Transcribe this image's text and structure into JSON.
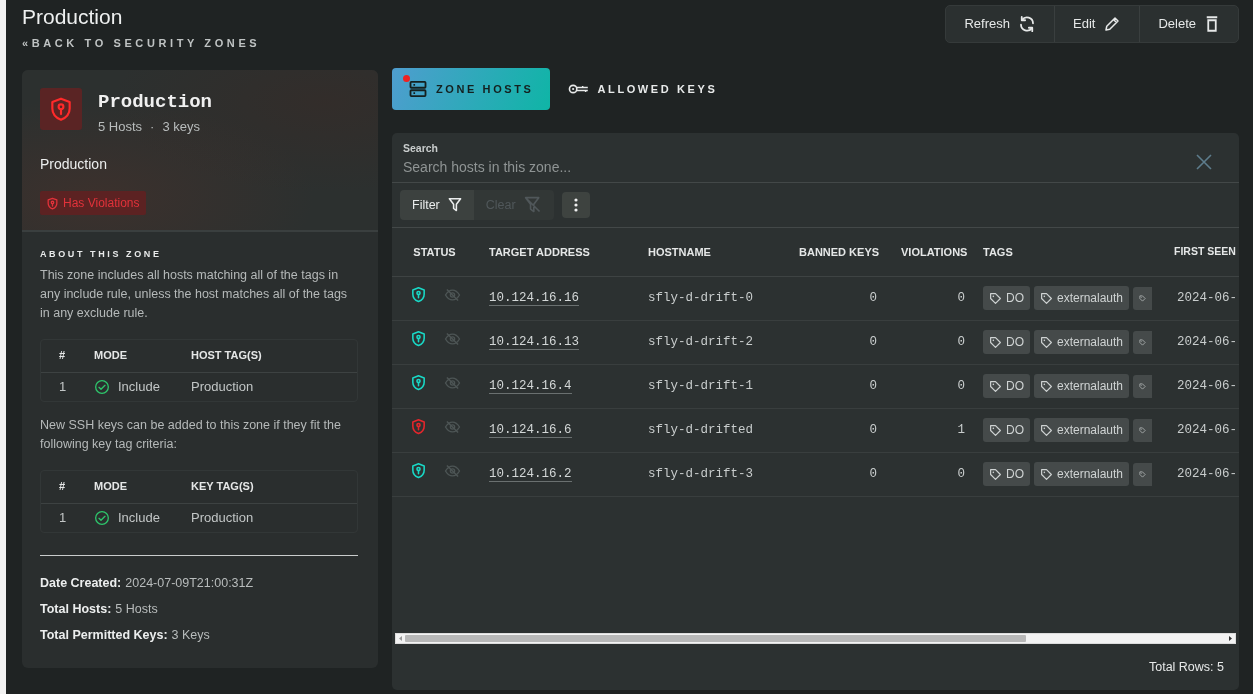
{
  "header": {
    "title": "Production",
    "back_link": "«BACK TO SECURITY ZONES"
  },
  "actions": [
    {
      "label": "Refresh",
      "kind": "refresh"
    },
    {
      "label": "Edit",
      "kind": "edit"
    },
    {
      "label": "Delete",
      "kind": "delete"
    }
  ],
  "zone_card": {
    "name": "Production",
    "hosts": "5 Hosts",
    "separator": "·",
    "keys": "3 keys",
    "description": "Production",
    "has_violations": true,
    "violation_badge": "Has Violations"
  },
  "about": {
    "heading": "ABOUT THIS ZONE",
    "intro": "This zone includes all hosts matching all of the tags in any include rule, unless the host matches all of the tags in any exclude rule.",
    "host_rules": {
      "columns": [
        "#",
        "MODE",
        "HOST TAG(S)"
      ],
      "rows": [
        {
          "index": "1",
          "mode": "Include",
          "kind": "include",
          "tag": "Production"
        }
      ]
    },
    "key_intro": "New SSH keys can be added to this zone if they fit the following key tag criteria:",
    "key_rules": {
      "columns": [
        "#",
        "MODE",
        "KEY TAG(S)"
      ],
      "rows": [
        {
          "index": "1",
          "mode": "Include",
          "kind": "include",
          "tag": "Production"
        }
      ]
    }
  },
  "details": [
    {
      "label": "Date Created:",
      "value": "2024-07-09T21:00:31Z"
    },
    {
      "label": "Total Hosts:",
      "value": "5 Hosts"
    },
    {
      "label": "Total Permitted Keys:",
      "value": "3 Keys"
    }
  ],
  "tabs": [
    {
      "label": "ZONE HOSTS",
      "kind": "hosts",
      "selected": true,
      "notification": true
    },
    {
      "label": "ALLOWED KEYS",
      "kind": "keys",
      "selected": false,
      "notification": false
    }
  ],
  "search": {
    "label": "Search",
    "placeholder": "Search hosts in this zone..."
  },
  "toolbar": {
    "filter": "Filter",
    "clear": "Clear",
    "clear_disabled": true
  },
  "hosts_table": {
    "columns": [
      "STATUS",
      "TARGET ADDRESS",
      "HOSTNAME",
      "BANNED KEYS",
      "VIOLATIONS",
      "TAGS",
      "FIRST SEEN"
    ],
    "rows": [
      {
        "has_violation": false,
        "address": "10.124.16.16",
        "hostname": "sfly-d-drift-0",
        "banned_keys": "0",
        "violations": "0",
        "tags": [
          "DO",
          "externalauth"
        ],
        "more_tags": true,
        "first_seen": "2024-06-"
      },
      {
        "has_violation": false,
        "address": "10.124.16.13",
        "hostname": "sfly-d-drift-2",
        "banned_keys": "0",
        "violations": "0",
        "tags": [
          "DO",
          "externalauth"
        ],
        "more_tags": true,
        "first_seen": "2024-06-"
      },
      {
        "has_violation": false,
        "address": "10.124.16.4",
        "hostname": "sfly-d-drift-1",
        "banned_keys": "0",
        "violations": "0",
        "tags": [
          "DO",
          "externalauth"
        ],
        "more_tags": true,
        "first_seen": "2024-06-"
      },
      {
        "has_violation": true,
        "address": "10.124.16.6",
        "hostname": "sfly-d-drifted",
        "banned_keys": "0",
        "violations": "1",
        "tags": [
          "DO",
          "externalauth"
        ],
        "more_tags": true,
        "first_seen": "2024-06-"
      },
      {
        "has_violation": false,
        "address": "10.124.16.2",
        "hostname": "sfly-d-drift-3",
        "banned_keys": "0",
        "violations": "0",
        "tags": [
          "DO",
          "externalauth"
        ],
        "more_tags": true,
        "first_seen": "2024-06-"
      }
    ]
  },
  "footer": {
    "total_rows": "Total Rows: 5"
  }
}
